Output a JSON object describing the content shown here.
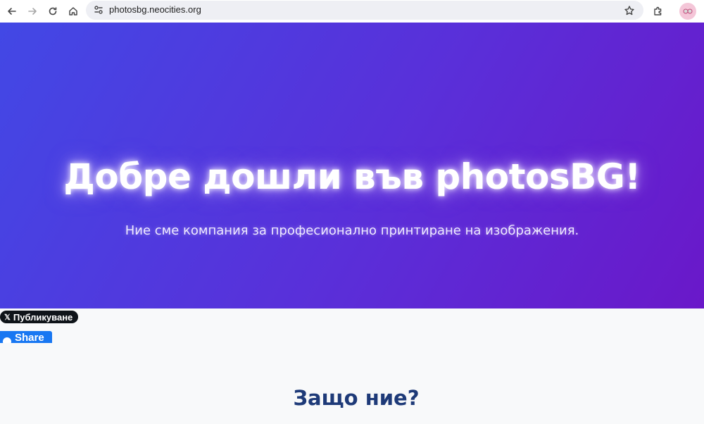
{
  "browser": {
    "url": "photosbg.neocities.org",
    "icons": {
      "back": "arrow-left-icon",
      "forward": "arrow-right-icon",
      "reload": "reload-icon",
      "home": "home-icon",
      "site_info": "tune-icon",
      "bookmark": "star-icon",
      "extensions": "puzzle-icon",
      "profile": "avatar-icon"
    }
  },
  "hero": {
    "title": "Добре дошли във photosBG!",
    "subtitle": "Ние сме компания за професионално принтиране на изображения.",
    "gradient_start": "#4248e5",
    "gradient_end": "#6a18c9"
  },
  "share": {
    "x_logo": "𝕏",
    "x_label": "Публикуване",
    "fb_label": "Share",
    "x_color": "#0f1419",
    "fb_color": "#1877f2"
  },
  "section": {
    "title": "Защо ние?",
    "title_color": "#1e3a78"
  }
}
